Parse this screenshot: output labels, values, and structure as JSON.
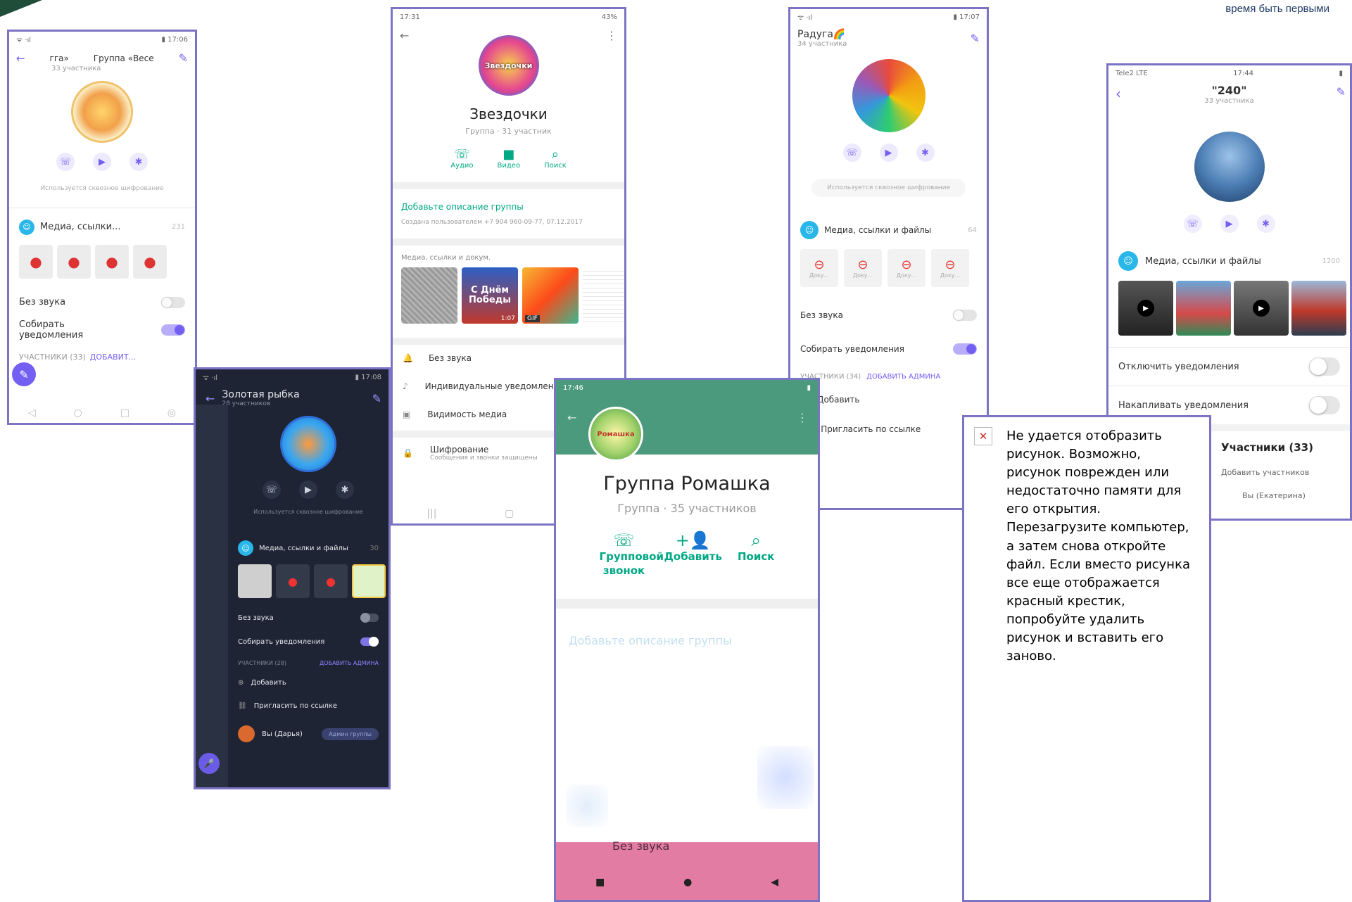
{
  "page": {
    "tagline": "время быть первыми"
  },
  "shot1": {
    "status_left": "ᯤ ‧ıl",
    "status_right": "▮ 17:06",
    "back_label": "←",
    "tab_left": "гга»",
    "title": "Группа «Весе",
    "subtitle": "33 участника",
    "encryption": "Используется сквозное шифрование",
    "media_label": "Медиа, ссылки...",
    "media_count": "231",
    "mute_label": "Без звука",
    "collect_label": "Собирать уведомления",
    "members_label": "УЧАСТНИКИ (33)",
    "add_label": "ДОБАВИТ..."
  },
  "shot2": {
    "status_left": "ᯤ ‧ıl",
    "status_right": "▮ 17:08",
    "title": "Золотая рыбка",
    "subtitle": "28 участников",
    "encryption": "Используется сквозное шифрование",
    "media_label": "Медиа, ссылки и файлы",
    "media_count": "30",
    "mute_label": "Без звука",
    "collect_label": "Собирать уведомления",
    "members_label": "УЧАСТНИКИ (28)",
    "add_admin_label": "ДОБАВИТЬ АДМИНА",
    "add_label": "Добавить",
    "invite_label": "Пригласить по ссылке",
    "member_name": "Вы (Дарья)",
    "member_role": "Админ группы"
  },
  "shot3": {
    "status_left": "17:31",
    "status_right": "43%",
    "logo_text": "Звездочки",
    "title": "Звездочки",
    "subtitle": "Группа · 31 участник",
    "actions": [
      {
        "label": "Аудио",
        "icon": "phone-icon"
      },
      {
        "label": "Видео",
        "icon": "video-icon"
      },
      {
        "label": "Поиск",
        "icon": "search-icon"
      }
    ],
    "add_description": "Добавьте описание группы",
    "created_by": "Создана пользователем +7 904 960-09-77, 07.12.2017",
    "media_label": "Медиа, ссылки и докум.",
    "thumb_caption": "С Днём Победы",
    "thumb_time": "1:07",
    "gif_label": "GIF",
    "settings": [
      {
        "label": "Без звука",
        "icon": "bell-icon"
      },
      {
        "label": "Индивидуальные уведомления",
        "icon": "music-note-icon"
      },
      {
        "label": "Видимость медиа",
        "icon": "image-icon"
      },
      {
        "label": "Шифрование",
        "icon": "lock-icon",
        "hint": "Сообщения и звонки защищены"
      }
    ]
  },
  "shot4": {
    "status_left": "ᯤ ‧ıl",
    "status_right": "▮ 17:07",
    "title": "Радуга🌈",
    "subtitle": "34 участника",
    "encryption": "Используется сквозное шифрование",
    "media_label": "Медиа, ссылки и файлы",
    "media_count": "64",
    "doc_label": "Доку...",
    "mute_label": "Без звука",
    "collect_label": "Собирать уведомления",
    "members_label": "УЧАСТНИКИ (34)",
    "add_admin_label": "ДОБАВИТЬ АДМИНА",
    "add_label": "Добавить",
    "invite_label": "Пригласить по ссылке"
  },
  "shot5": {
    "status_left": "17:46",
    "status_right": "▮",
    "logo_text": "Ромашка",
    "title": "Группа Ромашка",
    "subtitle": "Группа · 35 участников",
    "actions": [
      {
        "label": "Групповой звонок",
        "icon": "add-call-icon"
      },
      {
        "label": "Добавить",
        "icon": "add-person-icon"
      },
      {
        "label": "Поиск",
        "icon": "search-icon"
      }
    ],
    "add_description": "Добавьте описание группы",
    "bottom_text": "Без звука",
    "nav_square": "■",
    "nav_circle": "●",
    "nav_back": "◀"
  },
  "shot6": {
    "status_left": "Tele2 LTE",
    "status_time": "17:44",
    "status_right": "▮",
    "title": "\"240\"",
    "subtitle": "33 участника",
    "media_label": "Медиа, ссылки и файлы",
    "media_count": "1200",
    "disable_label": "Отключить уведомления",
    "accumulate_label": "Накапливать уведомления",
    "members_label": "Участники (33)",
    "add_members_label": "Добавить участников",
    "you_label": "Вы (Екатерина)"
  },
  "error": {
    "icon": "✕",
    "message": "Не удается отобразить рисунок. Возможно, рисунок поврежден или недостаточно памяти для его открытия. Перезагрузите компьютер, а затем снова откройте файл. Если вместо рисунка все еще отображается красный крестик, попробуйте удалить рисунок и вставить его заново."
  },
  "colors": {
    "frame": "#7b74c4",
    "viber": "#7360f2",
    "whatsapp": "#00a884",
    "whatsapp_header": "#4c9a7e",
    "dark_bg": "#1e2433",
    "pink": "#e37ca3",
    "error_red": "#d32f2f"
  }
}
